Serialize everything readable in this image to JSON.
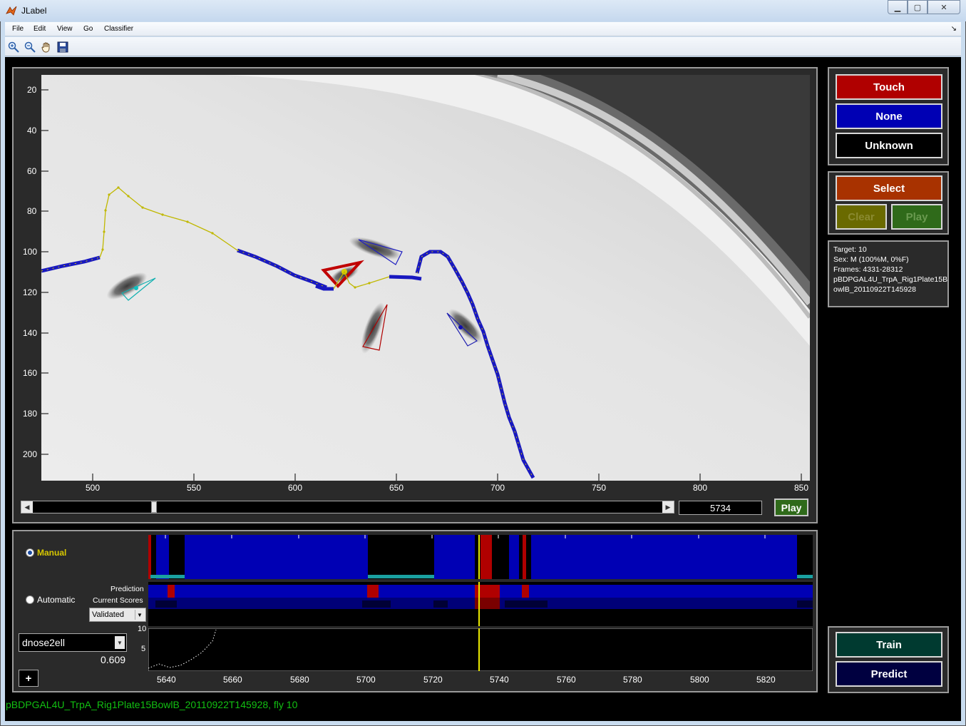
{
  "window": {
    "title": "JLabel"
  },
  "menu": [
    "File",
    "Edit",
    "View",
    "Go",
    "Classifier"
  ],
  "toolbar": {
    "tools": [
      "zoom-in-icon",
      "zoom-out-icon",
      "pan-hand-icon",
      "save-icon"
    ]
  },
  "video": {
    "y_ticks": [
      "20",
      "40",
      "60",
      "80",
      "100",
      "120",
      "140",
      "160",
      "180",
      "200"
    ],
    "x_ticks": [
      "500",
      "550",
      "600",
      "650",
      "700",
      "750",
      "800",
      "850"
    ],
    "frame_number": "5734",
    "play_label": "Play",
    "frame_slider_fraction": 0.19
  },
  "label_buttons": {
    "touch": "Touch",
    "none": "None",
    "unknown": "Unknown"
  },
  "select_panel": {
    "select": "Select",
    "clear": "Clear",
    "play": "Play"
  },
  "info": {
    "target": "Target: 10",
    "sex": "Sex: M (100%M, 0%F)",
    "frames": "Frames: 4331-28312",
    "experiment_line1": "pBDPGAL4U_TrpA_Rig1Plate15B",
    "experiment_line2": "owlB_20110922T145928"
  },
  "timeline": {
    "manual_label": "Manual",
    "automatic_label": "Automatic",
    "prediction_label": "Prediction",
    "current_scores_label": "Current Scores",
    "validated_option": "Validated",
    "feature_select": "dnose2ell",
    "feature_value": "0.609",
    "plus_label": "+",
    "y_ticks": [
      "10",
      "5"
    ],
    "x_ticks": [
      "5640",
      "5660",
      "5680",
      "5700",
      "5720",
      "5740",
      "5760",
      "5780",
      "5800",
      "5820"
    ]
  },
  "train_panel": {
    "train": "Train",
    "predict": "Predict"
  },
  "status_text": "pBDPGAL4U_TrpA_Rig1Plate15BowlB_20110922T145928, fly 10",
  "colors": {
    "touch": "#b00000",
    "none": "#0000b4",
    "unknown": "#000000",
    "select": "#a83200",
    "clear": "#6a6a00",
    "play": "#2f6a1a",
    "train": "#003a30",
    "predict": "#000040",
    "status_green": "#12c012",
    "manual_yellow": "#d8c800"
  }
}
